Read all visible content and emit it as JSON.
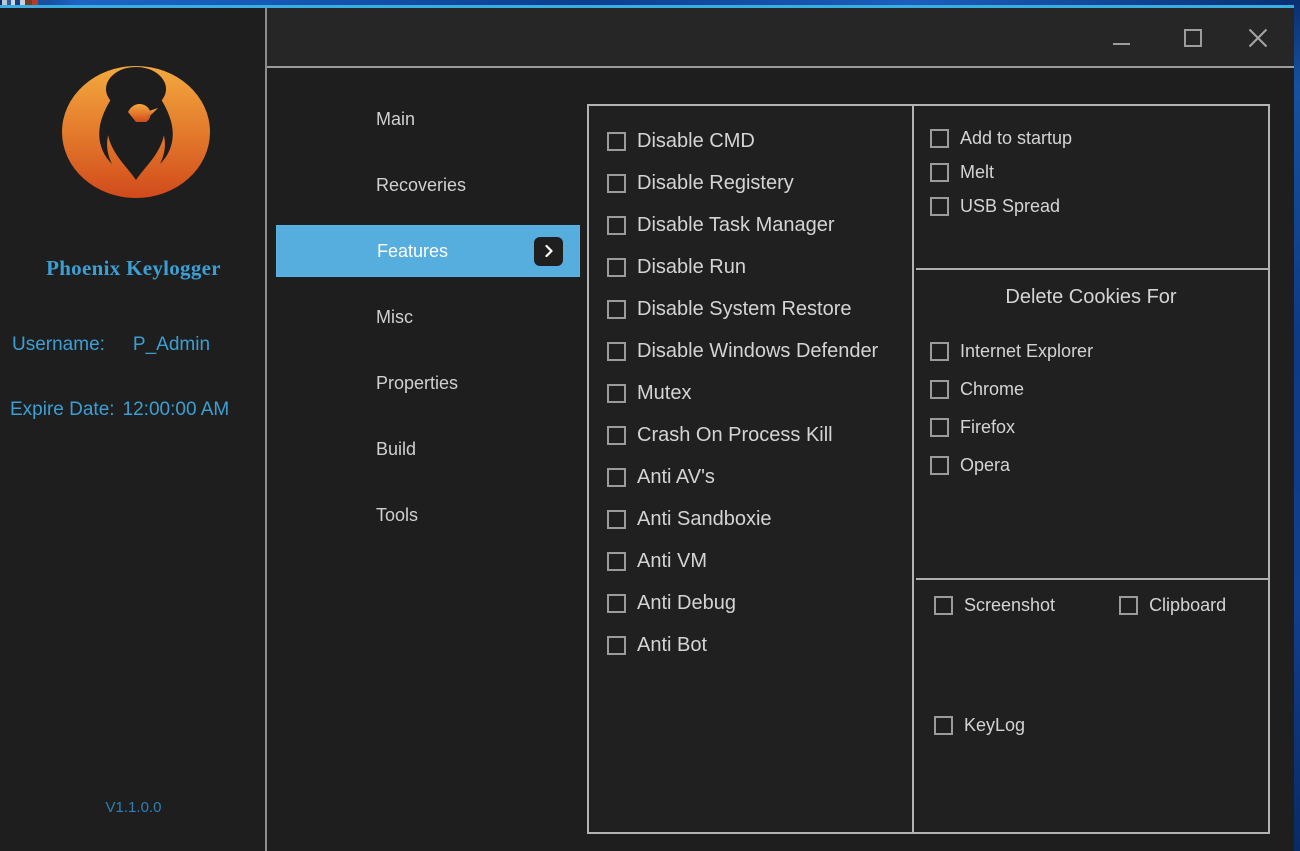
{
  "window": {
    "controls": {
      "minimize": "minimize",
      "maximize": "maximize",
      "close": "close"
    }
  },
  "sidebar": {
    "brand_title": "Phoenix Keylogger",
    "username_label": "Username:",
    "username_value": "P_Admin",
    "expire_label": "Expire Date:",
    "expire_value": "12:00:00 AM",
    "version": "V1.1.0.0",
    "accent_color": "#3b9fd4",
    "logo_color_top": "#f0a33c",
    "logo_color_bottom": "#d4521f"
  },
  "nav": {
    "active_index": 2,
    "active_color": "#55aede",
    "items": [
      {
        "label": "Main"
      },
      {
        "label": "Recoveries"
      },
      {
        "label": "Features"
      },
      {
        "label": "Misc"
      },
      {
        "label": "Properties"
      },
      {
        "label": "Build"
      },
      {
        "label": "Tools"
      }
    ]
  },
  "features": {
    "left_column": [
      {
        "label": "Disable CMD",
        "checked": false
      },
      {
        "label": "Disable Registery",
        "checked": false
      },
      {
        "label": "Disable Task Manager",
        "checked": false
      },
      {
        "label": "Disable Run",
        "checked": false
      },
      {
        "label": "Disable System Restore",
        "checked": false
      },
      {
        "label": "Disable Windows Defender",
        "checked": false
      },
      {
        "label": "Mutex",
        "checked": false
      },
      {
        "label": "Crash On Process Kill",
        "checked": false
      },
      {
        "label": "Anti AV's",
        "checked": false
      },
      {
        "label": "Anti Sandboxie",
        "checked": false
      },
      {
        "label": "Anti VM",
        "checked": false
      },
      {
        "label": "Anti Debug",
        "checked": false
      },
      {
        "label": "Anti Bot",
        "checked": false
      }
    ],
    "startup_group": [
      {
        "label": "Add to startup",
        "checked": false
      },
      {
        "label": "Melt",
        "checked": false
      },
      {
        "label": "USB Spread",
        "checked": false
      }
    ],
    "cookies_title": "Delete Cookies For",
    "cookies_group": [
      {
        "label": "Internet Explorer",
        "checked": false
      },
      {
        "label": "Chrome",
        "checked": false
      },
      {
        "label": "Firefox",
        "checked": false
      },
      {
        "label": "Opera",
        "checked": false
      }
    ],
    "capture_group": [
      {
        "label": "Screenshot",
        "checked": false
      },
      {
        "label": "Clipboard",
        "checked": false
      }
    ],
    "keylog_group": [
      {
        "label": "KeyLog",
        "checked": false
      }
    ]
  }
}
